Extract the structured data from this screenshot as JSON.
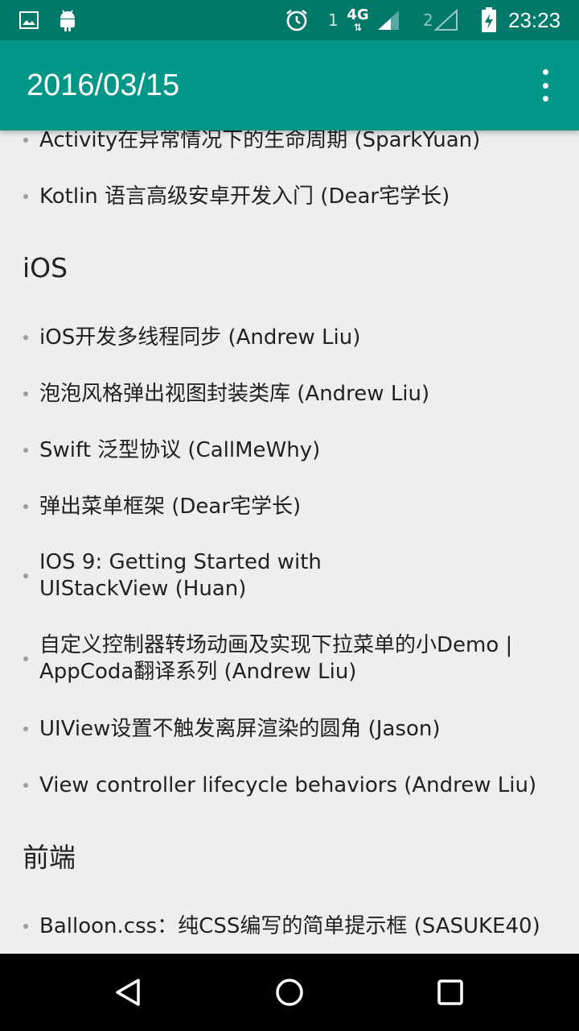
{
  "statusbar": {
    "sim1": "1",
    "network": "4G",
    "sim2": "2",
    "time": "23:23",
    "icons": [
      "image-icon",
      "android-icon",
      "alarm-icon",
      "signal-icon",
      "signal-empty-icon",
      "battery-charging-icon"
    ]
  },
  "appbar": {
    "title": "2016/03/15",
    "menu_icon": "more-vert-icon"
  },
  "sections": [
    {
      "title": "",
      "items": [
        "Activity在异常情况下的生命周期 (SparkYuan)",
        "Kotlin 语言高级安卓开发入门 (Dear宅学长)"
      ]
    },
    {
      "title": "iOS",
      "items": [
        "iOS开发多线程同步 (Andrew Liu)",
        "泡泡风格弹出视图封装类库 (Andrew Liu)",
        "Swift 泛型协议 (CallMeWhy)",
        "弹出菜单框架 (Dear宅学长)",
        "IOS 9: Getting Started with UIStackView (Huan)",
        "自定义控制器转场动画及实现下拉菜单的小Demo | AppCoda翻译系列 (Andrew Liu)",
        "UIView设置不触发离屏渲染的圆角 (Jason)",
        "View controller lifecycle behaviors (Andrew Liu)"
      ]
    },
    {
      "title": "前端",
      "items": [
        "Balloon.css：纯CSS编写的简单提示框 (SASUKE40)"
      ]
    }
  ],
  "navbar": {
    "icons": [
      "back-icon",
      "home-icon",
      "recents-icon"
    ]
  },
  "colors": {
    "statusbar": "#00796b",
    "appbar": "#009688",
    "background": "#eeeeee"
  }
}
